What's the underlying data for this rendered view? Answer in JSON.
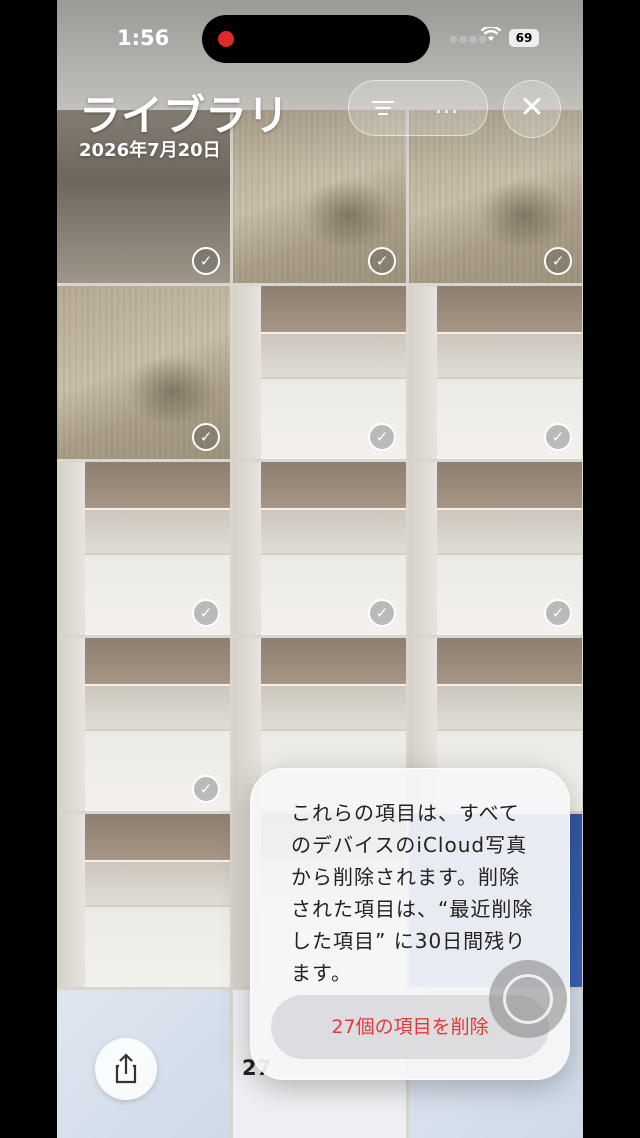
{
  "status_bar": {
    "time": "1:56",
    "battery": "69"
  },
  "header": {
    "title": "ライブラリ",
    "date": "2026年7月20日"
  },
  "toolbar": {
    "more_label": "..."
  },
  "footer": {
    "count_partial": "27"
  },
  "dialog": {
    "message": "これらの項目は、すべてのデバイスのiCloud写真から削除されます。削除された項目は、“最近削除した項目” に30日間残ります。",
    "delete_button": "27個の項目を削除"
  },
  "colors": {
    "destructive": "#e4393b",
    "record_dot": "#e02a2a"
  },
  "icons": [
    "filter-icon",
    "more-icon",
    "close-icon",
    "share-icon",
    "checkmark-icon",
    "assistive-touch-icon"
  ]
}
